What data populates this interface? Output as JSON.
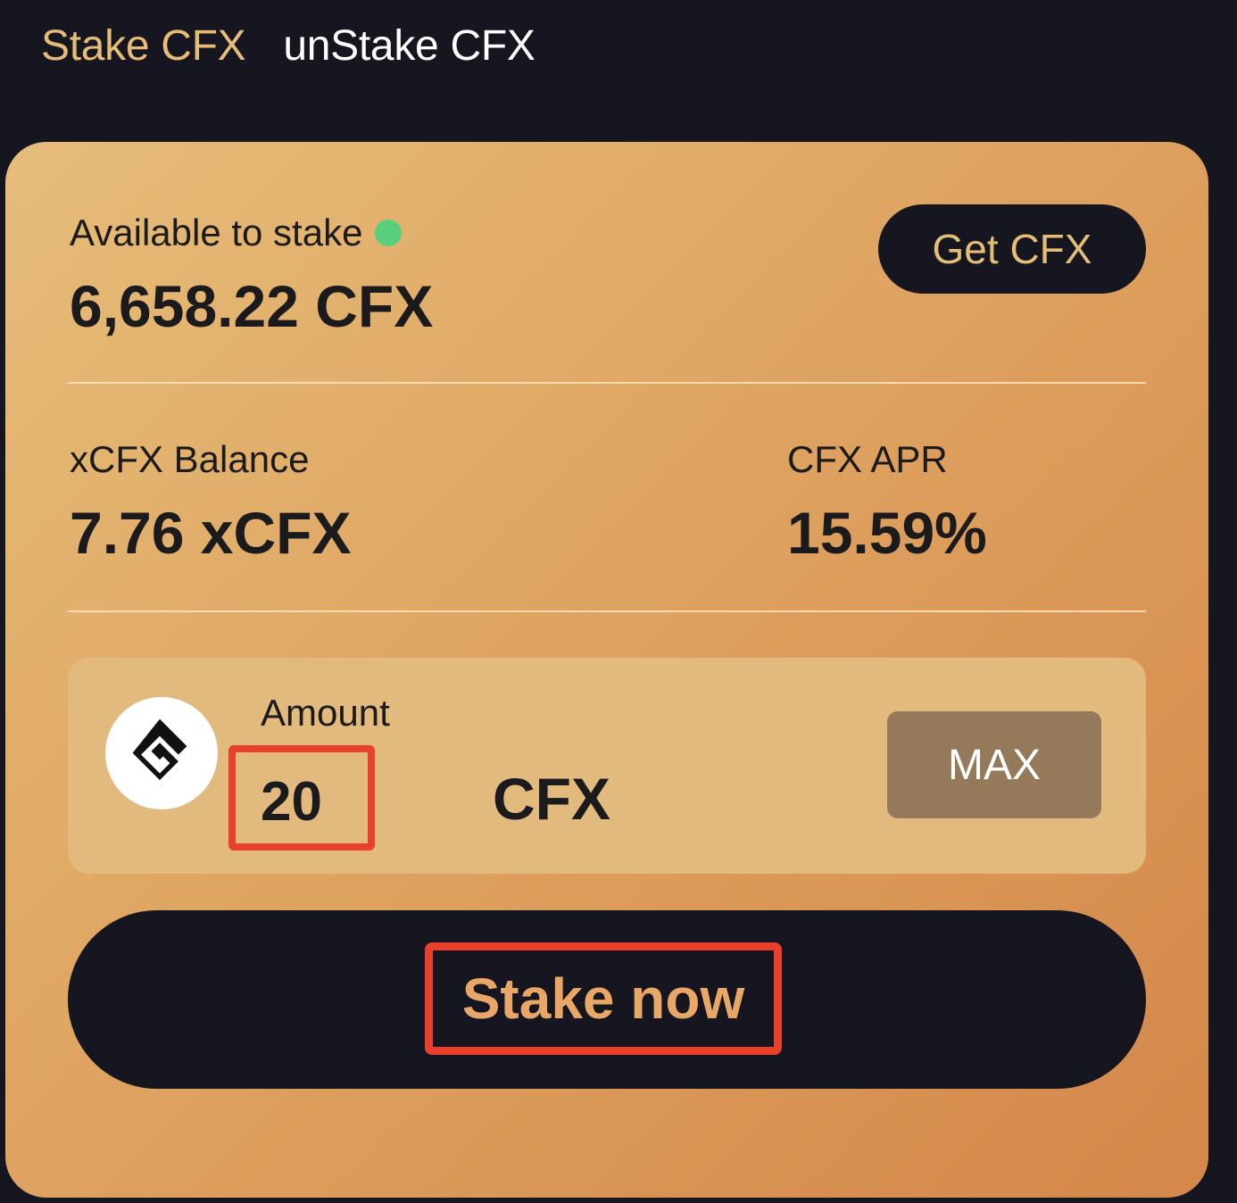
{
  "tabs": {
    "stake_label": "Stake CFX",
    "unstake_label": "unStake CFX"
  },
  "available": {
    "label": "Available to stake",
    "value": "6,658.22 CFX",
    "status_color": "#58cf7c"
  },
  "get_button": {
    "label": "Get CFX"
  },
  "balance": {
    "label": "xCFX Balance",
    "value": "7.76 xCFX"
  },
  "apr": {
    "label": "CFX APR",
    "value": "15.59%"
  },
  "amount": {
    "label": "Amount",
    "value": "20",
    "unit": "CFX",
    "token_icon": "conflux-logo-icon",
    "max_label": "MAX"
  },
  "stake_button": {
    "label": "Stake now"
  },
  "colors": {
    "accent": "#e6bd77",
    "background": "#161620",
    "highlight": "#e8402a"
  }
}
